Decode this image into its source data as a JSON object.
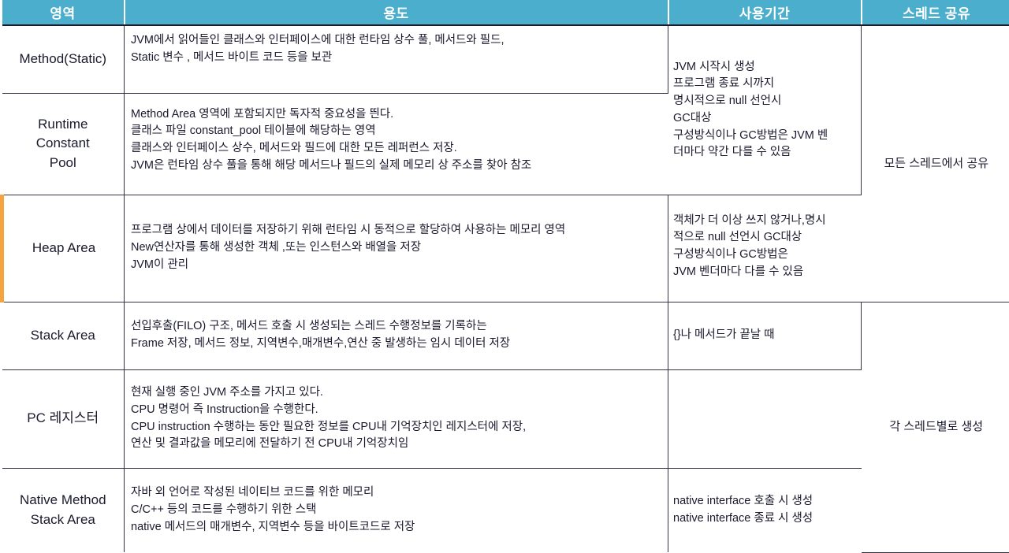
{
  "table": {
    "headers": [
      {
        "label": "영역",
        "name": "header-area"
      },
      {
        "label": "용도",
        "name": "header-usage"
      },
      {
        "label": "사용기간",
        "name": "header-lifetime"
      },
      {
        "label": "스레드 공유",
        "name": "header-thread-share"
      }
    ],
    "header_bg": "#4BAECD",
    "header_fg": "#FFFFFF",
    "accent_highlight": "#F5A33C",
    "rows": [
      {
        "area": "Method(Static)",
        "usage": "JVM에서 읽어들인 클래스와 인터페이스에 대한 런타임 상수 풀, 메서드와 필드,\nStatic 변수 , 메서드 바이트 코드 등을 보관",
        "lifetime": "JVM 시작시 생성\n프로그램 종료 시까지\n명시적으로 null 선언시\nGC대상\n구성방식이나 GC방법은 JVM 벤\n더마다 약간 다를 수 있음",
        "lifetime_rowspan": 2
      },
      {
        "area": "Runtime\nConstant\nPool",
        "usage": "Method Area 영역에 포함되지만 독자적 중요성을 띈다.\n클래스 파일 constant_pool 테이블에 해당하는 영역\n클래스와 인터페이스 상수, 메서드와 필드에 대한 모든 레퍼런스 저장.\nJVM은 런타임 상수 풀을 통해 해당 메서드나 필드의 실제 메모리 상 주소를 찾아 참조"
      },
      {
        "area": "Heap Area",
        "usage": "프로그램 상에서 데이터를 저장하기 위해 런타임 시 동적으로 할당하여 사용하는 메모리 영역\nNew연산자를 통해 생성한 객체 ,또는 인스턴스와 배열을 저장\nJVM이 관리",
        "lifetime": "객체가 더 이상 쓰지 않거나,명시\n적으로 null 선언시 GC대상\n구성방식이나 GC방법은\nJVM 벤더마다 다를 수 있음",
        "highlighted": true
      },
      {
        "area": "Stack Area",
        "usage": "선입후출(FILO) 구조, 메서드 호출 시 생성되는 스레드 수행정보를 기록하는\nFrame 저장, 메서드 정보, 지역변수,매개변수,연산 중 발생하는 임시 데이터 저장",
        "lifetime": "{}나 메서드가 끝날 때"
      },
      {
        "area": "PC 레지스터",
        "usage": "현재 실행 중인 JVM 주소를 가지고 있다.\nCPU 명령어 즉 Instruction을 수행한다.\nCPU instruction 수행하는 동안 필요한 정보를 CPU내 기억장치인 레지스터에 저장,\n연산 및 결과값을 메모리에 전달하기 전 CPU내 기억장치임",
        "lifetime": ""
      },
      {
        "area": "Native Method\nStack Area",
        "usage": "자바 외 언어로 작성된 네이티브 코드를 위한 메모리\nC/C++ 등의 코드를 수행하기 위한 스택\nnative 메서드의 매개변수, 지역변수 등을 바이트코드로 저장",
        "lifetime": "native interface 호출 시 생성\nnative interface 종료 시 생성"
      }
    ],
    "thread_share": [
      {
        "label": "모든 스레드에서 공유",
        "rowspan": 3
      },
      {
        "label": "각 스레드별로 생성",
        "rowspan": 3
      }
    ]
  }
}
